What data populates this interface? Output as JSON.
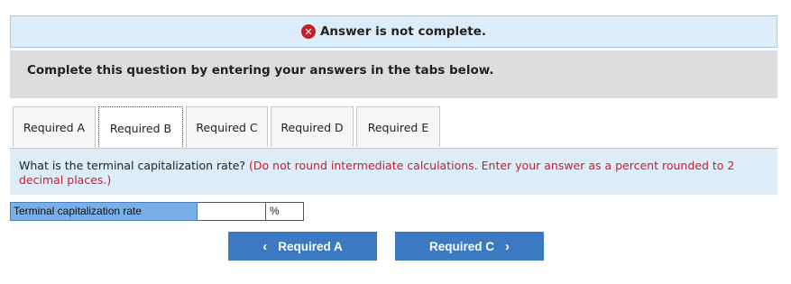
{
  "status": {
    "icon": "error-x-icon",
    "text": "Answer is not complete.",
    "color": "#c4202a"
  },
  "instruction": {
    "text": "Complete this question by entering your answers in the tabs below."
  },
  "tabs": [
    {
      "label": "Required A",
      "active": false
    },
    {
      "label": "Required B",
      "active": true
    },
    {
      "label": "Required C",
      "active": false
    },
    {
      "label": "Required D",
      "active": false
    },
    {
      "label": "Required E",
      "active": false
    }
  ],
  "question": {
    "text": "What is the terminal capitalization rate?",
    "note": "(Do not round intermediate calculations. Enter your answer as a percent rounded to 2 decimal places.)"
  },
  "answer": {
    "label": "Terminal capitalization rate",
    "value": "",
    "unit": "%"
  },
  "nav": {
    "prev_label": "Required A",
    "prev_icon": "chevron-left-icon",
    "next_label": "Required C",
    "next_icon": "chevron-right-icon"
  },
  "colors": {
    "banner_bg": "#dcecf8",
    "label_bg": "#79aee6",
    "button_bg": "#3c79c3"
  }
}
